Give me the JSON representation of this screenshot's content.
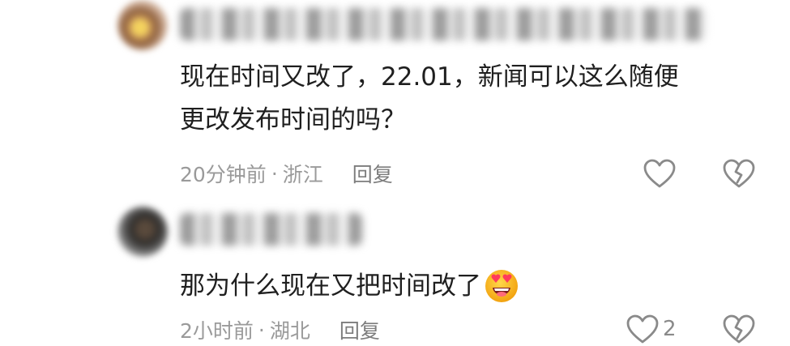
{
  "comments": [
    {
      "lines": [
        "现在时间又改了，22.01，新闻可以这么随便",
        "更改发布时间的吗？"
      ],
      "time": "20分钟前",
      "dot": "·",
      "location": "浙江",
      "reply_label": "回复",
      "like_count": ""
    },
    {
      "lines": [
        "那为什么现在又把时间改了"
      ],
      "time": "2小时前",
      "dot": "·",
      "location": "湖北",
      "reply_label": "回复",
      "like_count": "2"
    }
  ],
  "icons": {
    "like": "heart-outline-icon",
    "dislike": "broken-heart-icon",
    "emoji": "heart-eyes-emoji"
  },
  "colors": {
    "text": "#1f1f1f",
    "meta": "#9a9a9a",
    "icon": "#8a8a8a"
  }
}
